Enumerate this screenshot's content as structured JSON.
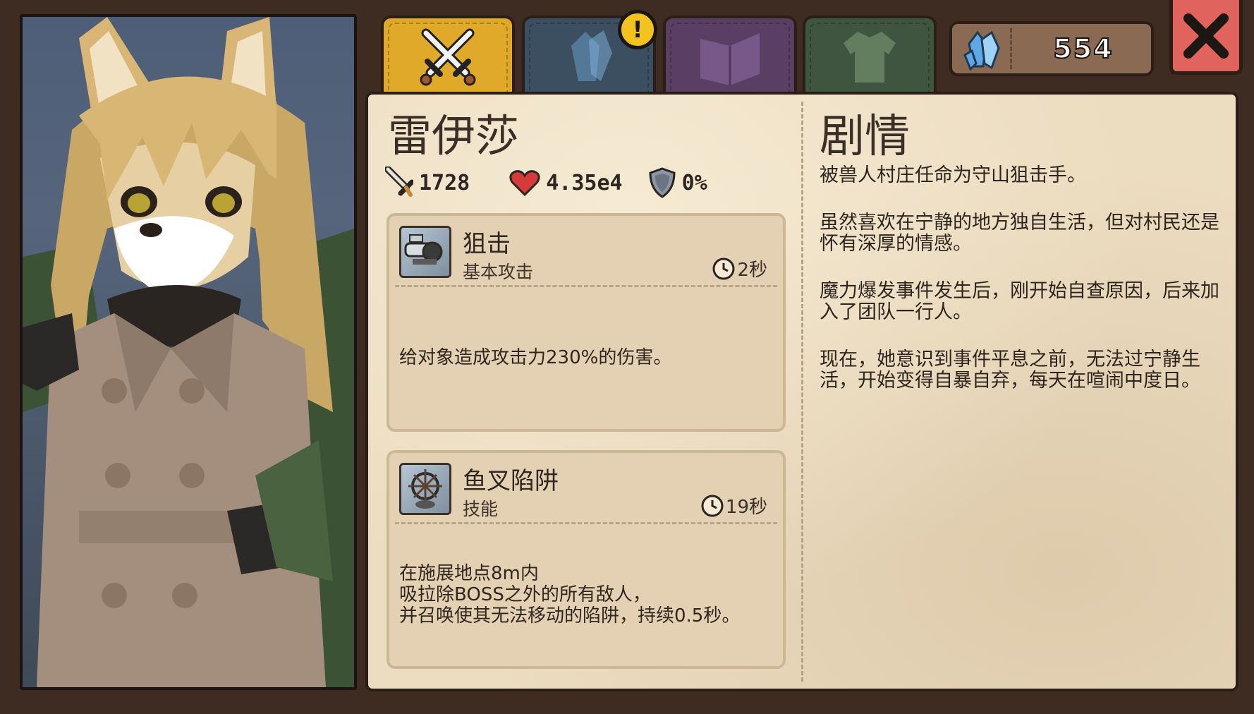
{
  "tabs": [
    {
      "name": "combat",
      "icon": "crossed-swords-icon",
      "color": "#e0a92a",
      "active": true
    },
    {
      "name": "crystal",
      "icon": "crystal-icon",
      "color": "#3b4f60"
    },
    {
      "name": "book",
      "icon": "book-icon",
      "color": "#5b3e63"
    },
    {
      "name": "outfit",
      "icon": "shirt-icon",
      "color": "#3f5540"
    }
  ],
  "alert_badge": "!",
  "currency": {
    "icon": "crystal-icon",
    "value": "554"
  },
  "character": {
    "name": "雷伊莎",
    "attack": "1728",
    "hp": "4.35e4",
    "defense": "0%"
  },
  "skills": [
    {
      "name": "狙击",
      "type": "基本攻击",
      "cooldown": "2秒",
      "desc": "给对象造成攻击力230%的伤害。"
    },
    {
      "name": "鱼叉陷阱",
      "type": "技能",
      "cooldown": "19秒",
      "desc_lines": [
        "在施展地点8m内",
        "吸拉除BOSS之外的所有敌人，",
        "并召唤使其无法移动的陷阱，持续0.5秒。"
      ]
    }
  ],
  "story": {
    "title": "剧情",
    "paragraphs": [
      "被兽人村庄任命为守山狙击手。",
      "虽然喜欢在宁静的地方独自生活，但对村民还是怀有深厚的情感。",
      "魔力爆发事件发生后，刚开始自查原因，后来加入了团队一行人。",
      "现在，她意识到事件平息之前，无法过宁静生活，开始变得自暴自弃，每天在喧闹中度日。"
    ]
  }
}
